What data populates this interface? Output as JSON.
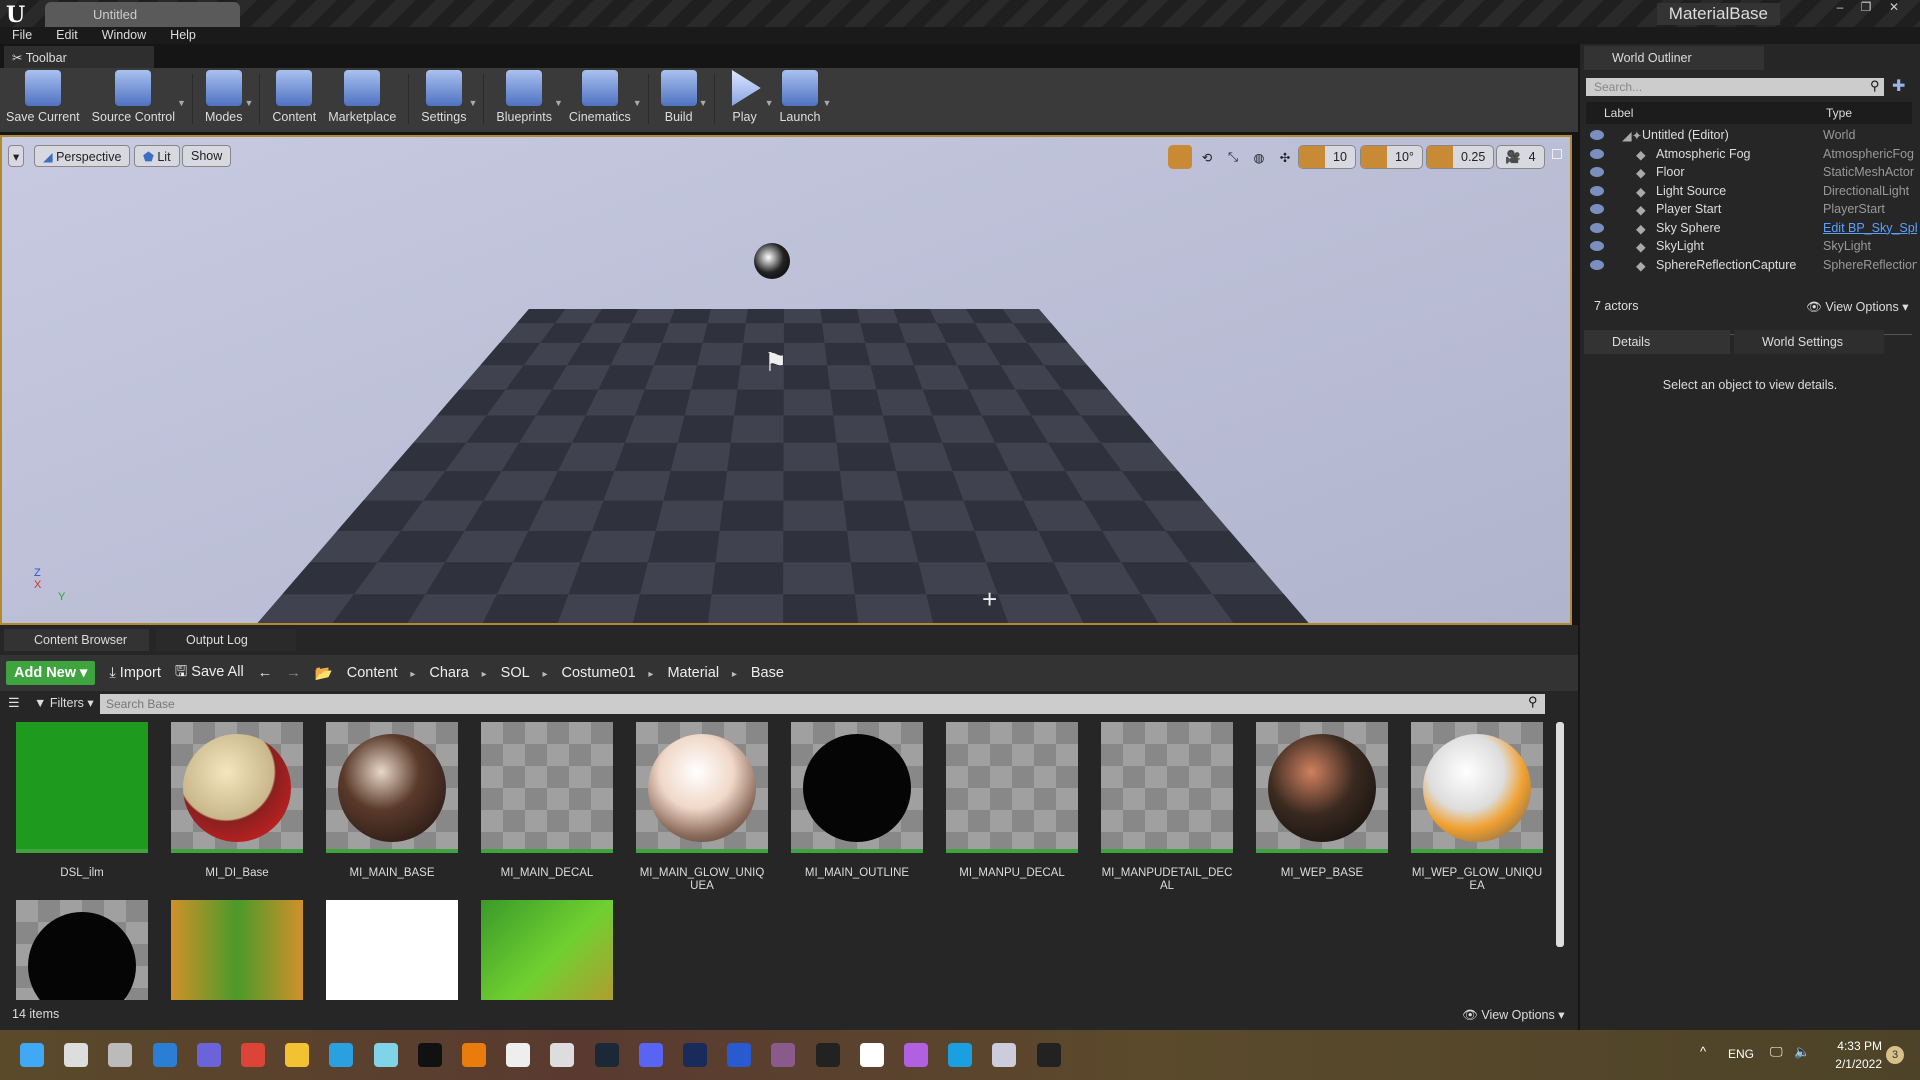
{
  "title": {
    "logo": "U",
    "doc_tab": "Untitled",
    "project": "MaterialBase"
  },
  "menu": [
    "File",
    "Edit",
    "Window",
    "Help"
  ],
  "toolbar": {
    "tab": "Toolbar",
    "buttons": [
      {
        "label": "Save Current",
        "icon": "save-icon"
      },
      {
        "label": "Source Control",
        "icon": "source-control-icon",
        "dropdown": true
      },
      {
        "label": "Modes",
        "icon": "modes-icon",
        "dropdown": true
      },
      {
        "label": "Content",
        "icon": "content-icon"
      },
      {
        "label": "Marketplace",
        "icon": "marketplace-icon"
      },
      {
        "label": "Settings",
        "icon": "settings-icon",
        "dropdown": true
      },
      {
        "label": "Blueprints",
        "icon": "blueprints-icon",
        "dropdown": true
      },
      {
        "label": "Cinematics",
        "icon": "cinematics-icon",
        "dropdown": true
      },
      {
        "label": "Build",
        "icon": "build-icon",
        "dropdown": true
      },
      {
        "label": "Play",
        "icon": "play-icon",
        "dropdown": true
      },
      {
        "label": "Launch",
        "icon": "launch-icon",
        "dropdown": true
      }
    ]
  },
  "viewport": {
    "perspective": "Perspective",
    "lit": "Lit",
    "show": "Show",
    "grid_snap": "10",
    "rotation_snap": "10°",
    "scale_snap": "0.25",
    "camera_speed": "4",
    "axis": {
      "z": "Z",
      "x": "X",
      "y": "Y"
    }
  },
  "outliner": {
    "tab": "World Outliner",
    "search_placeholder": "Search...",
    "col_label": "Label",
    "col_type": "Type",
    "rows": [
      {
        "label": "Untitled (Editor)",
        "type": "World"
      },
      {
        "label": "Atmospheric Fog",
        "type": "AtmosphericFog"
      },
      {
        "label": "Floor",
        "type": "StaticMeshActor"
      },
      {
        "label": "Light Source",
        "type": "DirectionalLight"
      },
      {
        "label": "Player Start",
        "type": "PlayerStart"
      },
      {
        "label": "Sky Sphere",
        "type": "Edit BP_Sky_Sphere",
        "link": true
      },
      {
        "label": "SkyLight",
        "type": "SkyLight"
      },
      {
        "label": "SphereReflectionCapture",
        "type": "SphereReflectionCapture"
      }
    ],
    "count": "7 actors",
    "view_options": "View Options"
  },
  "details": {
    "tab": "Details",
    "world_settings_tab": "World Settings",
    "empty": "Select an object to view details."
  },
  "content_browser": {
    "tab": "Content Browser",
    "output_tab": "Output Log",
    "add_new": "Add New",
    "import": "Import",
    "save_all": "Save All",
    "breadcrumb": [
      "Content",
      "Chara",
      "SOL",
      "Costume01",
      "Material",
      "Base"
    ],
    "filters": "Filters",
    "search_placeholder": "Search Base",
    "assets": [
      "DSL_ilm",
      "MI_DI_Base",
      "MI_MAIN_BASE",
      "MI_MAIN_DECAL",
      "MI_MAIN_GLOW_UNIQUEA",
      "MI_MAIN_OUTLINE",
      "MI_MANPU_DECAL",
      "MI_MANPUDETAIL_DECAL",
      "MI_WEP_BASE",
      "MI_WEP_GLOW_UNIQUEA",
      "",
      "",
      "",
      ""
    ],
    "count": "14 items",
    "view_options": "View Options"
  },
  "taskbar": {
    "lang": "ENG",
    "time": "4:33 PM",
    "date": "2/1/2022",
    "notifications": "3"
  },
  "colors": {
    "accent": "#3fa33f",
    "snap_active": "#c98a35",
    "link": "#5aa0ff"
  }
}
